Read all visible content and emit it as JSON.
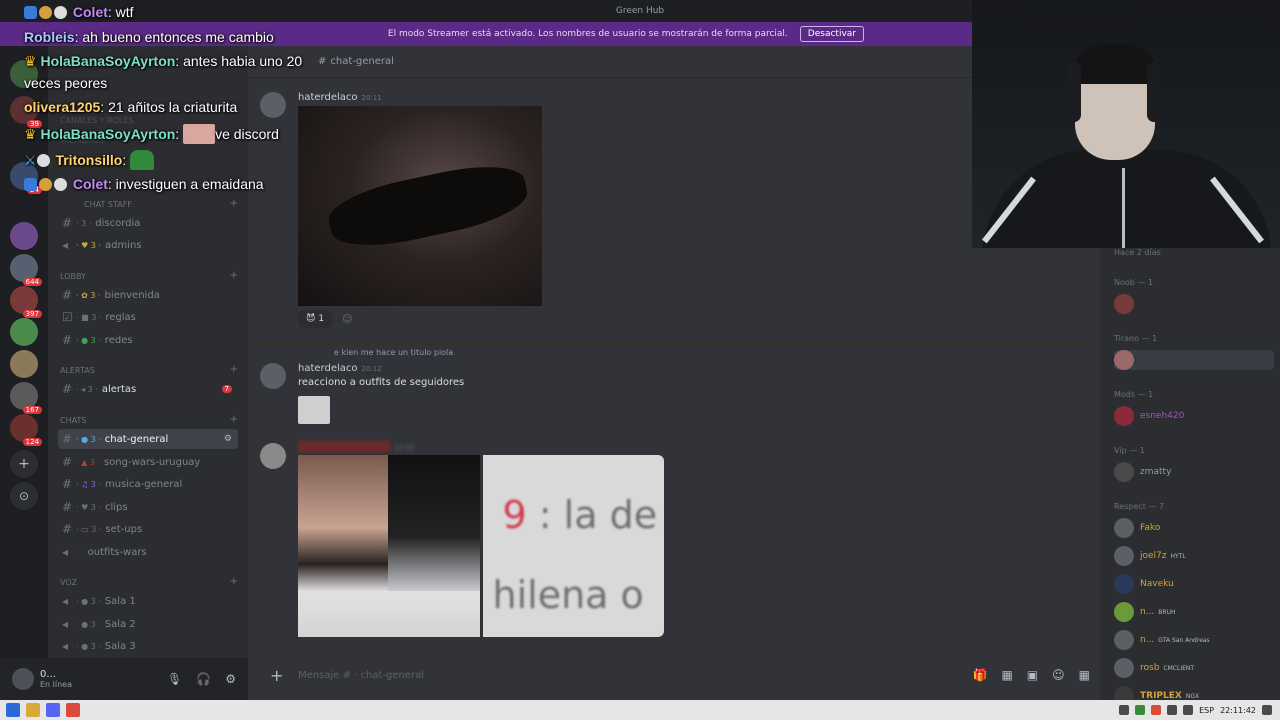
{
  "window": {
    "title": "Green Hub"
  },
  "streamer_bar": {
    "message": "El modo Streamer está activado. Los nombres de usuario se mostrarán de forma parcial.",
    "button_label": "Desactivar"
  },
  "channel_header": {
    "name": "chat-general"
  },
  "sidebar": {
    "hidden_items": [
      "Canales y roles",
      "Miembros"
    ],
    "categories": [
      {
        "label": "Chat Staff"
      },
      {
        "label": "LOBBY"
      },
      {
        "label": "ALERTAS"
      },
      {
        "label": "CHATS"
      },
      {
        "label": "VOZ"
      }
    ],
    "channels": [
      {
        "name": "discordia"
      },
      {
        "name": "admins"
      },
      {
        "name": "bienvenida"
      },
      {
        "name": "reglas"
      },
      {
        "name": "redes"
      },
      {
        "name": "alertas",
        "badge": "7"
      },
      {
        "name": "chat-general"
      },
      {
        "name": "song-wars-uruguay"
      },
      {
        "name": "musica-general"
      },
      {
        "name": "clips"
      },
      {
        "name": "set-ups"
      },
      {
        "name": "outfits-wars"
      },
      {
        "name": "Sala 1"
      },
      {
        "name": "Sala 2"
      },
      {
        "name": "Sala 3"
      }
    ]
  },
  "servers": {
    "badges": [
      "39",
      "24",
      "644",
      "397",
      "167",
      "124"
    ]
  },
  "user_panel": {
    "name": "0...",
    "status": "En línea"
  },
  "messages": [
    {
      "author": "haterdelaco",
      "time": "20:11",
      "reaction_count": "1"
    },
    {
      "reply_text": "e kien me hace un titulo piola",
      "author": "haterdelaco",
      "time": "20:12",
      "text": "reacciono a outfits de seguidores"
    },
    {
      "time": "22:12"
    }
  ],
  "gallery": {
    "line1_red": "9",
    "line1": " : la de",
    "line2": "hilena o"
  },
  "composer": {
    "placeholder": "Mensaje # · chat-general"
  },
  "members": {
    "top_label": "Hace 2 días",
    "groups": [
      {
        "label": "Noob — 1"
      },
      {
        "label": "Tirano — 1"
      },
      {
        "label": "Mods — 1"
      },
      {
        "label": "Vip — 1"
      },
      {
        "label": "Respect — 7"
      }
    ],
    "list": [
      {
        "name": ""
      },
      {
        "name": ""
      },
      {
        "name": "esneh420"
      },
      {
        "name": "zmatty"
      },
      {
        "name": "Fako"
      },
      {
        "name": "joel7z",
        "tag": "HYTL"
      },
      {
        "name": "Naveku"
      },
      {
        "name": "n...",
        "tag": "BRUH"
      },
      {
        "name": "n...",
        "tag": "GTA San Andreas"
      },
      {
        "name": "rosb",
        "tag": "CMCLIENT"
      },
      {
        "name": "TRIPLEX",
        "tag": "NGX"
      }
    ]
  },
  "stream_chat": [
    {
      "user": "Colet",
      "text": ": wtf",
      "color": "#c58af9"
    },
    {
      "user": "Robleis",
      "text": ": ah bueno entonces me cambio",
      "color": "#a9c8ff"
    },
    {
      "user": "HolaBanaSoyAyrton",
      "text": ": antes habia uno 20",
      "color": "#7ee0c3"
    },
    {
      "text": "veces peores"
    },
    {
      "user": "olivera1205",
      "text": ": 21 añitos la criaturita",
      "color": "#ffd36e"
    },
    {
      "user": "HolaBanaSoyAyrton",
      "text": "ve discord",
      "color": "#7ee0c3"
    },
    {
      "user": "Tritonsillo",
      "text": ":",
      "color": "#ffd36e"
    },
    {
      "user": "Colet",
      "text": ": investiguen a emaidana",
      "color": "#c58af9"
    }
  ],
  "taskbar": {
    "lang": "ESP",
    "time": "22:11:42"
  }
}
